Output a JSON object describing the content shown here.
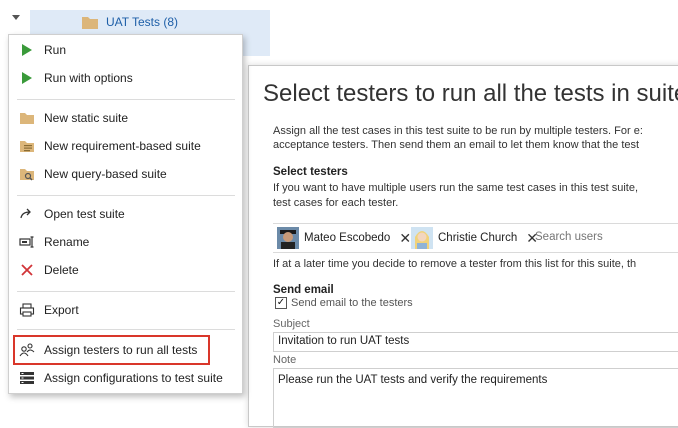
{
  "tree": {
    "selected_node": "UAT Tests (8)",
    "icon": "folder-icon"
  },
  "menu": {
    "items": [
      {
        "label": "Run",
        "icon": "play-icon"
      },
      {
        "label": "Run with options",
        "icon": "play-icon"
      },
      {
        "label": "New static suite",
        "icon": "folder-icon"
      },
      {
        "label": "New requirement-based suite",
        "icon": "requirement-suite-icon"
      },
      {
        "label": "New query-based suite",
        "icon": "query-suite-icon"
      },
      {
        "label": "Open test suite",
        "icon": "open-arrow-icon"
      },
      {
        "label": "Rename",
        "icon": "rename-icon"
      },
      {
        "label": "Delete",
        "icon": "delete-x-icon"
      },
      {
        "label": "Export",
        "icon": "printer-icon"
      },
      {
        "label": "Assign testers to run all tests",
        "icon": "assign-users-icon"
      },
      {
        "label": "Assign configurations to test suite",
        "icon": "configurations-icon"
      }
    ],
    "highlighted_item": "Assign testers to run all tests",
    "colors": {
      "play": "#3a9a3a",
      "delete": "#d13438",
      "folder": "#dcb67a",
      "highlight": "#d9362a"
    }
  },
  "dialog": {
    "title": "Select testers to run all the tests in suite",
    "intro_line1": "Assign all the test cases in this test suite to be run by multiple testers. For e:",
    "intro_line2": "acceptance testers. Then send them an email to let them know that the test",
    "select_heading": "Select testers",
    "select_line1": "If you want to have multiple users run the same test cases in this test suite,",
    "select_line2": "test cases for each tester.",
    "testers": [
      {
        "name": "Mateo Escobedo",
        "avatar": "avatar-mateo"
      },
      {
        "name": "Christie Church",
        "avatar": "avatar-christie"
      }
    ],
    "remove_glyph": "✕",
    "search_placeholder": "Search users",
    "removal_note": "If at a later time you decide to remove a tester from this list for this suite, th",
    "send_email_heading": "Send email",
    "send_email_checkbox": "Send email to the testers",
    "send_email_checked": true,
    "subject_label": "Subject",
    "subject_value": "Invitation to run UAT  tests",
    "note_label": "Note",
    "note_value": "Please run the UAT tests and verify the requirements"
  }
}
